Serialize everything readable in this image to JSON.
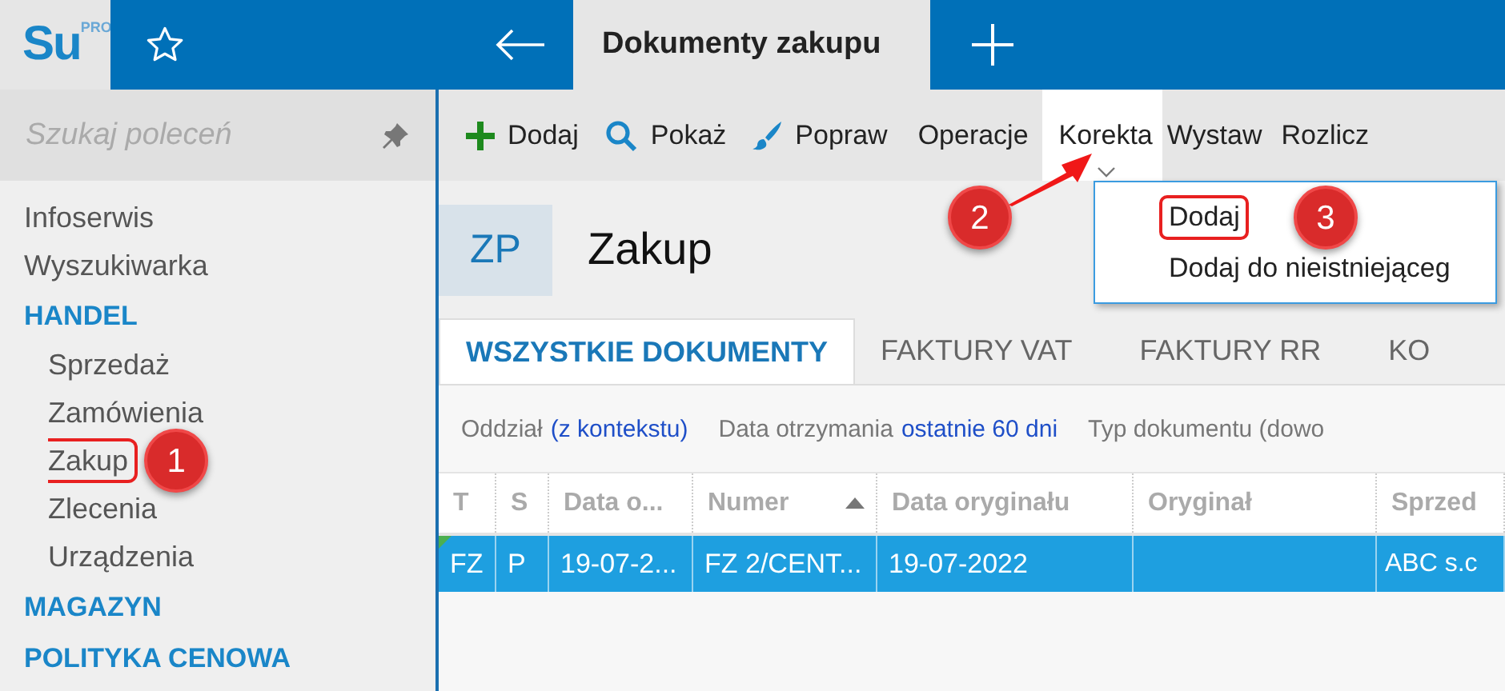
{
  "app": {
    "logo": "Su",
    "logo_badge": "PRO"
  },
  "tabs": [
    {
      "label": "Dokumenty zakupu",
      "selected": true
    }
  ],
  "sidebar": {
    "search": {
      "placeholder": "Szukaj poleceń"
    },
    "items": [
      {
        "kind": "link",
        "label": "Infoserwis"
      },
      {
        "kind": "link",
        "label": "Wyszukiwarka"
      },
      {
        "kind": "section",
        "label": "HANDEL",
        "children": [
          {
            "label": "Sprzedaż",
            "outlined": false
          },
          {
            "label": "Zamówienia",
            "outlined": false
          },
          {
            "label": "Zakup",
            "outlined": true,
            "callout": "1"
          },
          {
            "label": "Zlecenia",
            "outlined": false
          },
          {
            "label": "Urządzenia",
            "outlined": false
          }
        ]
      },
      {
        "kind": "section",
        "label": "MAGAZYN"
      },
      {
        "kind": "section",
        "label": "POLITYKA CENOWA"
      }
    ]
  },
  "toolbar": [
    {
      "kind": "add",
      "label": "Dodaj",
      "open": false
    },
    {
      "kind": "search",
      "label": "Pokaż",
      "open": false
    },
    {
      "kind": "edit",
      "label": "Popraw",
      "open": false
    },
    {
      "kind": "text",
      "label": "Operacje",
      "open": false
    },
    {
      "kind": "text",
      "label": "Korekta",
      "open": true,
      "callout": "2"
    },
    {
      "kind": "text",
      "label": "Wystaw",
      "open": false
    },
    {
      "kind": "text",
      "label": "Rozlicz",
      "open": false
    }
  ],
  "dropdown": {
    "callout": "3",
    "items": [
      {
        "label": "Dodaj",
        "outlined": true
      },
      {
        "label": "Dodaj do nieistniejąceg",
        "outlined": false
      }
    ]
  },
  "header": {
    "code": "ZP",
    "title": "Zakup"
  },
  "doc_tabs": [
    {
      "label": "WSZYSTKIE DOKUMENTY",
      "selected": true
    },
    {
      "label": "FAKTURY VAT",
      "selected": false
    },
    {
      "label": "FAKTURY RR",
      "selected": false
    },
    {
      "label": "KO",
      "selected": false
    }
  ],
  "filters": [
    {
      "label": "Oddział",
      "value": "(z kontekstu)"
    },
    {
      "label": "Data otrzymania",
      "value": "ostatnie 60 dni"
    },
    {
      "label": "Typ dokumentu (dowo"
    }
  ],
  "table": {
    "columns": [
      {
        "label": "T",
        "sorted": false
      },
      {
        "label": "S",
        "sorted": false
      },
      {
        "label": "Data o...",
        "sorted": false
      },
      {
        "label": "Numer",
        "sorted": true
      },
      {
        "label": "Data oryginału",
        "sorted": false
      },
      {
        "label": "Oryginał",
        "sorted": false
      },
      {
        "label": "Sprzed",
        "sorted": false
      }
    ],
    "rows": [
      {
        "selected": true,
        "flagged": true,
        "cells": [
          "FZ",
          "P",
          "19-07-2...",
          "FZ 2/CENT...",
          "19-07-2022",
          "",
          "ABC s.c"
        ]
      }
    ]
  }
}
